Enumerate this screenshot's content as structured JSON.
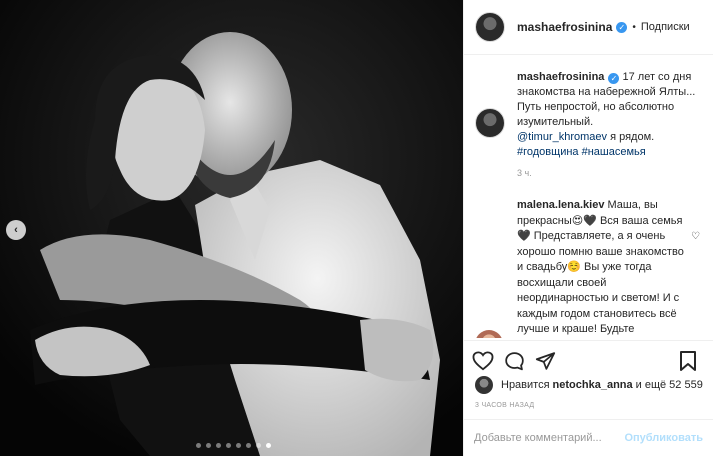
{
  "post": {
    "username": "mashaefrosinina",
    "follow_label": "Подписки",
    "separator": "•"
  },
  "caption": {
    "username": "mashaefrosinina",
    "text_1": "17 лет со дня знакомства на набережной Ялты... Путь непростой, но абсолютно изумительный.",
    "mention": "@timur_khromaev",
    "text_2": " я рядом.",
    "hashtags": "#годовщина #нашасемья",
    "time": "3 ч."
  },
  "comment": {
    "username": "malena.lena.kiev",
    "text": "Маша, вы прекрасны😍🖤 Вся ваша семья🖤 Представляете, а я очень хорошо помню ваше знакомство и свадьбу☺️ Вы уже тогда восхищали своей неординарностью и светом! И с каждым годом становитесь всё лучше и краше! Будьте счастливы🖤 P.S. Помню, что в то время имя Тимур было..."
  },
  "likes": {
    "prefix": "Нравится",
    "user": "netochka_anna",
    "suffix": "и ещё 52 559"
  },
  "ago": "3 ЧАСОВ НАЗАД",
  "add_comment": {
    "placeholder": "Добавьте комментарий...",
    "publish_label": "Опубликовать"
  },
  "carousel": {
    "count": 8,
    "active_index": 7
  },
  "colors": {
    "link": "#003569",
    "verified": "#3897f0",
    "publish_disabled": "#b2dffc"
  }
}
